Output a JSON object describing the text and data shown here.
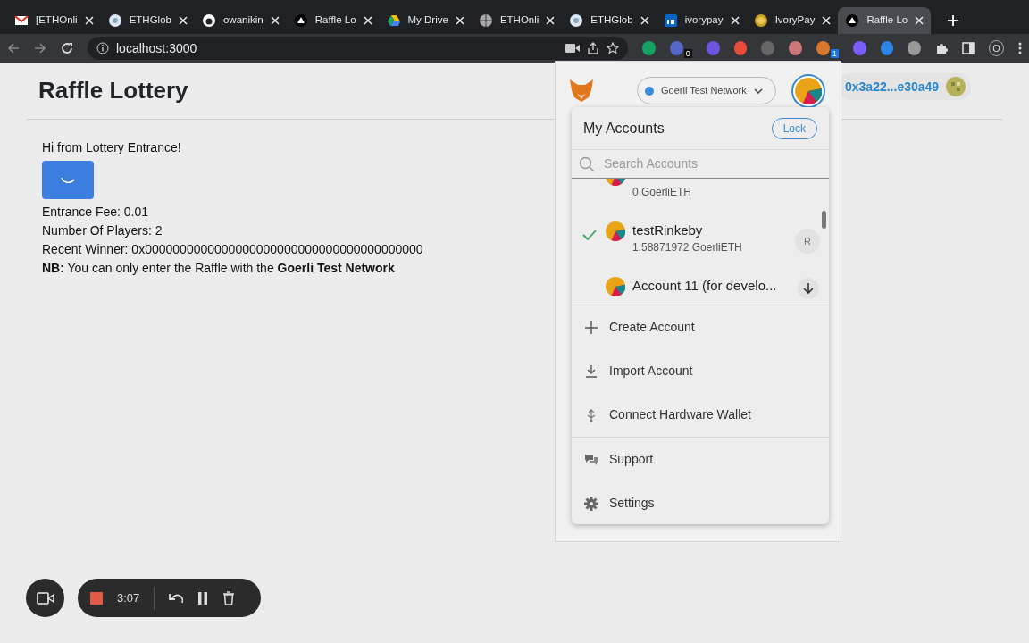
{
  "browser": {
    "tabs": [
      {
        "title": "[ETHOnli",
        "selected": false
      },
      {
        "title": "ETHGlob",
        "selected": false
      },
      {
        "title": "owanikin",
        "selected": false
      },
      {
        "title": "Raffle Lo",
        "selected": false
      },
      {
        "title": "My Drive",
        "selected": false
      },
      {
        "title": "ETHOnli",
        "selected": false
      },
      {
        "title": "ETHGlob",
        "selected": false
      },
      {
        "title": "ivorypay",
        "selected": false
      },
      {
        "title": "IvoryPay",
        "selected": false
      },
      {
        "title": "Raffle Lo",
        "selected": true
      }
    ],
    "address": "localhost:3000",
    "extension_badges": [
      "0",
      "1"
    ],
    "profile_initial": "O"
  },
  "page": {
    "title": "Raffle Lottery",
    "wallet_address": "0x3a22...e30a49",
    "greeting": "Hi from Lottery Entrance!",
    "button_loading": true,
    "lines": [
      "Entrance Fee: 0.01",
      "Number Of Players: 2",
      "Recent Winner: 0x0000000000000000000000000000000000000000"
    ],
    "note": "**NB:** You can only enter the Raffle with the **Goerli Test Network**"
  },
  "wallet": {
    "network": "Goerli Test Network",
    "menu": {
      "title": "My Accounts",
      "lock": "Lock",
      "search_placeholder": "Search Accounts",
      "accounts": [
        {
          "kind": "plain",
          "balance": "0 GoerliETH",
          "selected": false
        },
        {
          "kind": "tagged",
          "name": "testRinkeby",
          "balance": "1.58871972 GoerliETH",
          "tag": "R",
          "selected": true
        },
        {
          "kind": "imported",
          "name": "Account 11 (for develo...",
          "selected": false
        }
      ],
      "actions": [
        {
          "kind": "create",
          "label": "Create Account"
        },
        {
          "kind": "import",
          "label": "Import Account"
        },
        {
          "kind": "hardware",
          "label": "Connect Hardware Wallet"
        }
      ],
      "links": [
        {
          "kind": "support",
          "label": "Support"
        },
        {
          "kind": "settings",
          "label": "Settings"
        }
      ]
    }
  },
  "recorder": {
    "time": "3:07"
  }
}
